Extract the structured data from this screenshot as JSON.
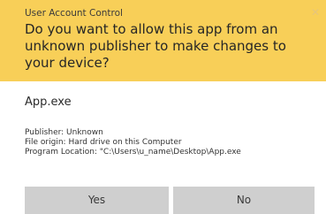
{
  "header": {
    "title": "User Account Control",
    "question": "Do you want to allow this app from an unknown publisher to make changes to your device?",
    "close_icon": "close-icon"
  },
  "app": {
    "name": "App.exe"
  },
  "details": {
    "publisher": "Publisher: Unknown",
    "file_origin": "File origin: Hard drive on this Computer",
    "program_location": "Program Location: \"C:\\Users\\u_name\\Desktop\\App.exe"
  },
  "buttons": {
    "yes_label": "Yes",
    "no_label": "No"
  },
  "colors": {
    "header_background": "#f8cf58",
    "button_background": "#cfcfcf"
  }
}
